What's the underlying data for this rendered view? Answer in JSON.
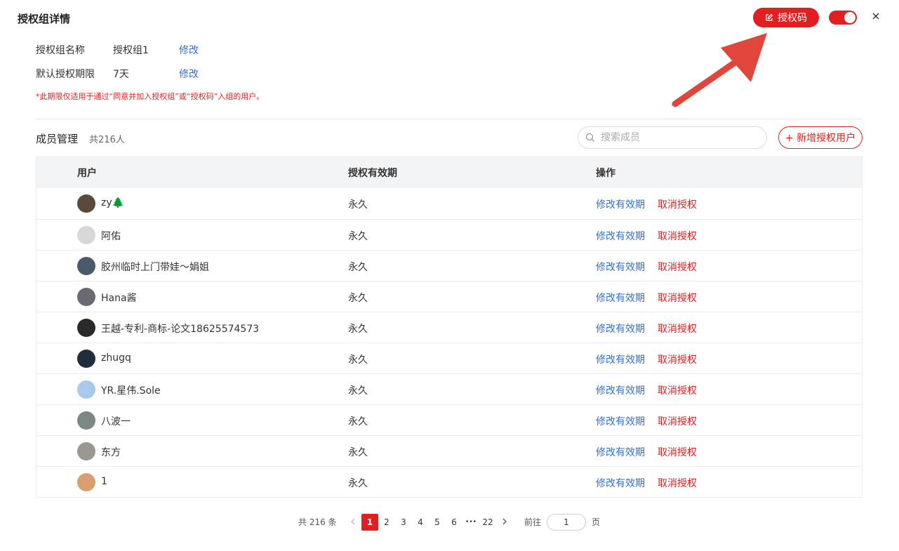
{
  "header": {
    "title": "授权组详情",
    "code_button_label": "授权码",
    "toggle_on": true,
    "close_icon": "close-icon"
  },
  "info": {
    "name_label": "授权组名称",
    "name_value": "授权组1",
    "name_edit": "修改",
    "period_label": "默认授权期限",
    "period_value": "7天",
    "period_edit": "修改",
    "notice": "*此期限仅适用于通过“同意并加入授权组”或“授权码”入组的用户。"
  },
  "members": {
    "title": "成员管理",
    "count": "共216人",
    "search_placeholder": "搜索成员",
    "add_button": "+ 新增授权用户"
  },
  "table": {
    "headers": [
      "用户",
      "授权有效期",
      "操作"
    ],
    "edit_label": "修改有效期",
    "cancel_label": "取消授权",
    "rows": [
      {
        "name": "zy🌲",
        "validity": "永久",
        "avatar_color": "#5a4a3a"
      },
      {
        "name": "阿佑",
        "validity": "永久",
        "avatar_color": "#d8d8d8"
      },
      {
        "name": "胶州临时上门带娃～娟姐",
        "validity": "永久",
        "avatar_color": "#4a5a6a"
      },
      {
        "name": "Hana酱",
        "validity": "永久",
        "avatar_color": "#6a6a72"
      },
      {
        "name": "王越-专利-商标-论文18625574573",
        "validity": "永久",
        "avatar_color": "#2a2a2a"
      },
      {
        "name": "zhugq",
        "validity": "永久",
        "avatar_color": "#1e2f3a"
      },
      {
        "name": "YR.星伟.Sole",
        "validity": "永久",
        "avatar_color": "#a9c9ec"
      },
      {
        "name": "八波一",
        "validity": "永久",
        "avatar_color": "#7a8a82"
      },
      {
        "name": "东方",
        "validity": "永久",
        "avatar_color": "#9a9890"
      },
      {
        "name": "1",
        "validity": "永久",
        "avatar_color": "#d8a070"
      }
    ]
  },
  "pagination": {
    "total": "共 216 条",
    "pages": [
      "1",
      "2",
      "3",
      "4",
      "5",
      "6"
    ],
    "ellipsis": "•••",
    "last_page": "22",
    "current": "1",
    "goto_label": "前往",
    "goto_value": "1",
    "page_suffix": "页"
  },
  "colors": {
    "accent": "#e02020",
    "link": "#2f6fd1"
  }
}
